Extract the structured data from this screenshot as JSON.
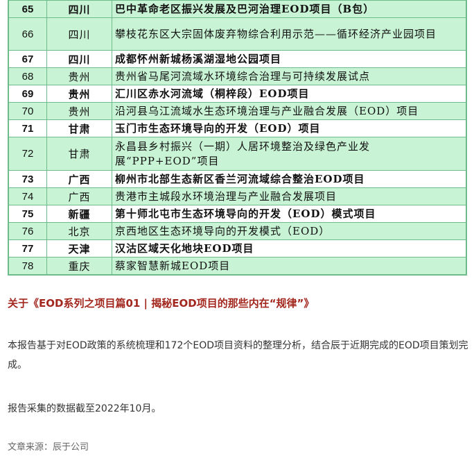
{
  "table": {
    "rows": [
      {
        "num": "65",
        "province": "四川",
        "name": "巴中革命老区振兴发展及巴河治理EOD项目（B包）",
        "style": "bold",
        "shade": "alt"
      },
      {
        "num": "66",
        "province": "四川",
        "name": "攀枝花东区大宗固体废弃物综合利用示范——循环经济产业园项目",
        "style": "norm",
        "shade": "alt"
      },
      {
        "num": "67",
        "province": "四川",
        "name": "成都怀州新城杨溪湖湿地公园项目",
        "style": "bold",
        "shade": "plain"
      },
      {
        "num": "68",
        "province": "贵州",
        "name": "贵州省马尾河流域水环境综合治理与可持续发展试点",
        "style": "norm",
        "shade": "alt"
      },
      {
        "num": "69",
        "province": "贵州",
        "name": "汇川区赤水河流域（桐梓段）EOD项目",
        "style": "bold",
        "shade": "plain"
      },
      {
        "num": "70",
        "province": "贵州",
        "name": "沿河县乌江流域水生态环境治理与产业融合发展（EOD）项目",
        "style": "norm",
        "shade": "alt"
      },
      {
        "num": "71",
        "province": "甘肃",
        "name": "玉门市生态环境导向的开发（EOD）项目",
        "style": "bold",
        "shade": "plain"
      },
      {
        "num": "72",
        "province": "甘肃",
        "name": "永昌县乡村振兴（一期）人居环境整治及绿色产业发展“PPP+EOD”项目",
        "style": "norm",
        "shade": "alt"
      },
      {
        "num": "73",
        "province": "广西",
        "name": "柳州市北部生态新区香兰河流域综合整治EOD项目",
        "style": "bold",
        "shade": "plain"
      },
      {
        "num": "74",
        "province": "广西",
        "name": "贵港市主城段水环境治理与产业融合发展项目",
        "style": "norm",
        "shade": "alt"
      },
      {
        "num": "75",
        "province": "新疆",
        "name": "第十师北屯市生态环境导向的开发（EOD）模式项目",
        "style": "bold",
        "shade": "plain"
      },
      {
        "num": "76",
        "province": "北京",
        "name": "京西地区生态环境导向的开发模式（EOD）",
        "style": "norm",
        "shade": "alt"
      },
      {
        "num": "77",
        "province": "天津",
        "name": "汉沽区域天化地块EOD项目",
        "style": "bold",
        "shade": "plain"
      },
      {
        "num": "78",
        "province": "重庆",
        "name": "蔡家智慧新城EOD项目",
        "style": "norm",
        "shade": "alt"
      }
    ]
  },
  "ref_link": "关于《EOD系列之项目篇01 | 揭秘EOD项目的那些内在“规律”》",
  "paragraph1": "本报告基于对EOD政策的系统梳理和172个EOD项目资料的整理分析，结合辰于近期完成的EOD项目策划完成。",
  "paragraph2": "报告采集的数据截至2022年10月。",
  "source": "文章来源：辰于公司",
  "colors": {
    "row_alt": "#c8f3d4",
    "border": "#6dbb8a",
    "link": "#a2271e"
  }
}
